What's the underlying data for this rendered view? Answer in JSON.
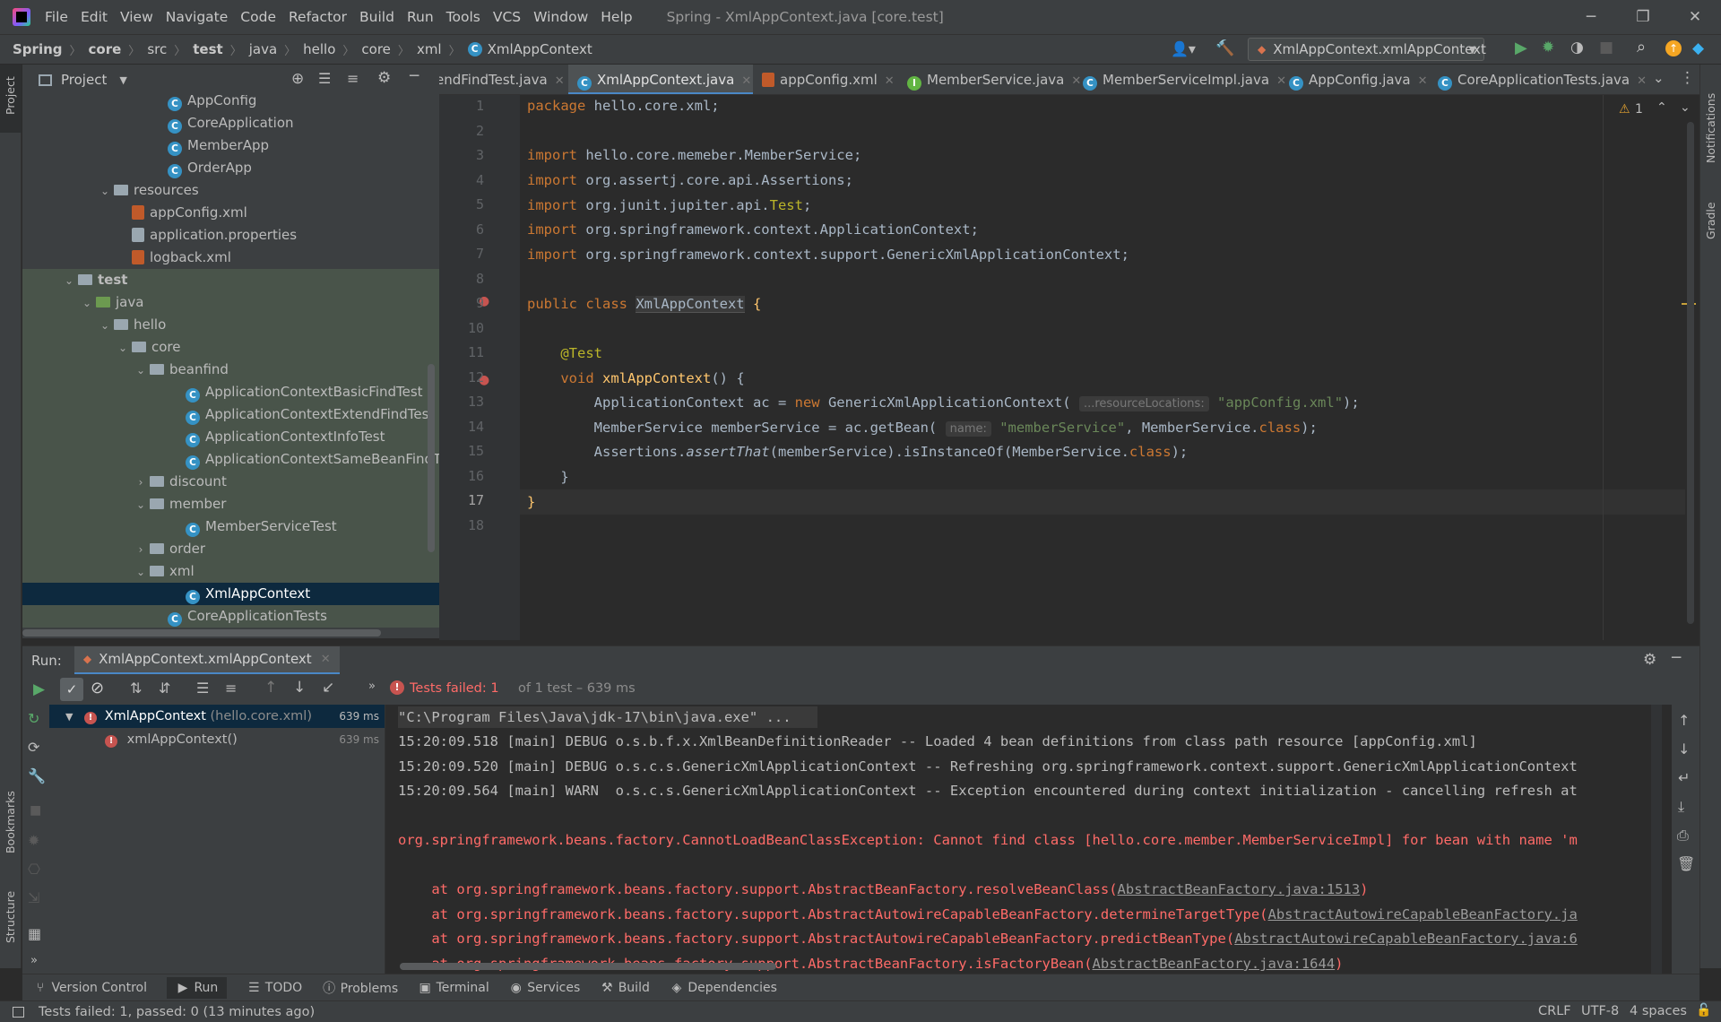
{
  "titlebar": {
    "menu": [
      "File",
      "Edit",
      "View",
      "Navigate",
      "Code",
      "Refactor",
      "Build",
      "Run",
      "Tools",
      "VCS",
      "Window",
      "Help"
    ],
    "title": "Spring - XmlAppContext.java [core.test]"
  },
  "breadcrumb": [
    "Spring",
    "core",
    "src",
    "test",
    "java",
    "hello",
    "core",
    "xml",
    "XmlAppContext"
  ],
  "run_config": "XmlAppContext.xmlAppContext",
  "project": {
    "header": "Project",
    "tree": [
      {
        "label": "AppConfig",
        "depth": 8,
        "icon": "class"
      },
      {
        "label": "CoreApplication",
        "depth": 8,
        "icon": "class"
      },
      {
        "label": "MemberApp",
        "depth": 8,
        "icon": "class"
      },
      {
        "label": "OrderApp",
        "depth": 8,
        "icon": "class"
      },
      {
        "label": "resources",
        "depth": 5,
        "icon": "folder",
        "chevron": "down"
      },
      {
        "label": "appConfig.xml",
        "depth": 6,
        "icon": "xml"
      },
      {
        "label": "application.properties",
        "depth": 6,
        "icon": "props"
      },
      {
        "label": "logback.xml",
        "depth": 6,
        "icon": "xml"
      },
      {
        "label": "test",
        "depth": 3,
        "icon": "folder",
        "chevron": "down",
        "bold": true
      },
      {
        "label": "java",
        "depth": 4,
        "icon": "folder-green",
        "chevron": "down"
      },
      {
        "label": "hello",
        "depth": 5,
        "icon": "folder",
        "chevron": "down"
      },
      {
        "label": "core",
        "depth": 6,
        "icon": "folder",
        "chevron": "down"
      },
      {
        "label": "beanfind",
        "depth": 7,
        "icon": "folder",
        "chevron": "down"
      },
      {
        "label": "ApplicationContextBasicFindTest",
        "depth": 9,
        "icon": "class"
      },
      {
        "label": "ApplicationContextExtendFindTest",
        "depth": 9,
        "icon": "class"
      },
      {
        "label": "ApplicationContextInfoTest",
        "depth": 9,
        "icon": "class"
      },
      {
        "label": "ApplicationContextSameBeanFindTest",
        "depth": 9,
        "icon": "class"
      },
      {
        "label": "discount",
        "depth": 7,
        "icon": "folder",
        "chevron": "right"
      },
      {
        "label": "member",
        "depth": 7,
        "icon": "folder",
        "chevron": "down"
      },
      {
        "label": "MemberServiceTest",
        "depth": 9,
        "icon": "class"
      },
      {
        "label": "order",
        "depth": 7,
        "icon": "folder",
        "chevron": "right"
      },
      {
        "label": "xml",
        "depth": 7,
        "icon": "folder",
        "chevron": "down"
      },
      {
        "label": "XmlAppContext",
        "depth": 9,
        "icon": "class",
        "selected": true
      },
      {
        "label": "CoreApplicationTests",
        "depth": 8,
        "icon": "class"
      }
    ]
  },
  "editor_tabs": [
    {
      "label": "endFindTest.java",
      "icon": "class"
    },
    {
      "label": "XmlAppContext.java",
      "icon": "class",
      "active": true
    },
    {
      "label": "appConfig.xml",
      "icon": "xml"
    },
    {
      "label": "MemberService.java",
      "icon": "interface"
    },
    {
      "label": "MemberServiceImpl.java",
      "icon": "class"
    },
    {
      "label": "AppConfig.java",
      "icon": "class"
    },
    {
      "label": "CoreApplicationTests.java",
      "icon": "class"
    }
  ],
  "editor": {
    "warning_count": "1",
    "line_numbers": [
      "1",
      "2",
      "3",
      "4",
      "5",
      "6",
      "7",
      "8",
      "9",
      "10",
      "11",
      "12",
      "13",
      "14",
      "15",
      "16",
      "17",
      "18"
    ],
    "code": {
      "l1_kw": "package",
      "l1_rest": " hello.core.xml;",
      "l3_kw": "import",
      "l3_rest": " hello.core.memeber.MemberService;",
      "l4_kw": "import",
      "l4_rest": " org.assertj.core.api.Assertions;",
      "l5_kw": "import",
      "l5_rest": " org.junit.jupiter.api.",
      "l5_ann": "Test",
      "l5_end": ";",
      "l6_kw": "import",
      "l6_rest": " org.springframework.context.ApplicationContext;",
      "l7_kw": "import",
      "l7_rest": " org.springframework.context.support.GenericXmlApplicationContext;",
      "l9_kw": "public class",
      "l9_cls": "XmlAppContext",
      "l9_end": " {",
      "l11_ann": "@Test",
      "l12_kw": "void",
      "l12_fn": "xmlAppContext",
      "l12_end": "() {",
      "l13_a": "ApplicationContext ac = ",
      "l13_kw": "new",
      "l13_b": " GenericXmlApplicationContext(",
      "l13_hint": "...resourceLocations:",
      "l13_str": "\"appConfig.xml\"",
      "l13_end": ");",
      "l14_a": "MemberService memberService = ac.getBean(",
      "l14_hint": "name:",
      "l14_str": "\"memberService\"",
      "l14_b": ", MemberService.",
      "l14_kw": "class",
      "l14_end": ");",
      "l15_a": "Assertions.",
      "l15_it": "assertThat",
      "l15_b": "(memberService).isInstanceOf(MemberService.",
      "l15_kw": "class",
      "l15_end": ");",
      "l16": "}",
      "l17": "}"
    }
  },
  "run": {
    "label": "Run:",
    "tab": "XmlAppContext.xmlAppContext",
    "status_failed": "Tests failed: 1",
    "status_rest": "of 1 test – 639 ms",
    "tests": [
      {
        "name": "XmlAppContext",
        "pkg": "(hello.core.xml)",
        "time": "639 ms"
      },
      {
        "name": "xmlAppContext()",
        "pkg": "",
        "time": "639 ms"
      }
    ],
    "console": {
      "l1": "\"C:\\Program Files\\Java\\jdk-17\\bin\\java.exe\" ...",
      "l2": "15:20:09.518 [main] DEBUG o.s.b.f.x.XmlBeanDefinitionReader -- Loaded 4 bean definitions from class path resource [appConfig.xml]",
      "l3": "15:20:09.520 [main] DEBUG o.s.c.s.GenericXmlApplicationContext -- Refreshing org.springframework.context.support.GenericXmlApplicationContext",
      "l4": "15:20:09.564 [main] WARN  o.s.c.s.GenericXmlApplicationContext -- Exception encountered during context initialization - cancelling refresh at",
      "l6": "org.springframework.beans.factory.CannotLoadBeanClassException: Cannot find class [hello.core.member.MemberServiceImpl] for bean with name 'm",
      "l8a": "    at org.springframework.beans.factory.support.AbstractBeanFactory.resolveBeanClass(",
      "l8link": "AbstractBeanFactory.java:1513",
      "l8end": ")",
      "l9a": "    at org.springframework.beans.factory.support.AbstractAutowireCapableBeanFactory.determineTargetType(",
      "l9link": "AbstractAutowireCapableBeanFactory.ja",
      "l10a": "    at org.springframework.beans.factory.support.AbstractAutowireCapableBeanFactory.predictBeanType(",
      "l10link": "AbstractAutowireCapableBeanFactory.java:6",
      "l11a": "    at org.springframework.beans.factory.support.AbstractBeanFactory.isFactoryBean(",
      "l11link": "AbstractBeanFactory.java:1644",
      "l11end": ")"
    }
  },
  "tool_windows": [
    "Version Control",
    "Run",
    "TODO",
    "Problems",
    "Terminal",
    "Services",
    "Build",
    "Dependencies"
  ],
  "side_labels": {
    "left_top": "Project",
    "left_bookmarks": "Bookmarks",
    "left_structure": "Structure",
    "right_notifications": "Notifications",
    "right_gradle": "Gradle"
  },
  "status": {
    "message": "Tests failed: 1, passed: 0 (13 minutes ago)",
    "line_sep": "CRLF",
    "encoding": "UTF-8",
    "indent": "4 spaces"
  }
}
